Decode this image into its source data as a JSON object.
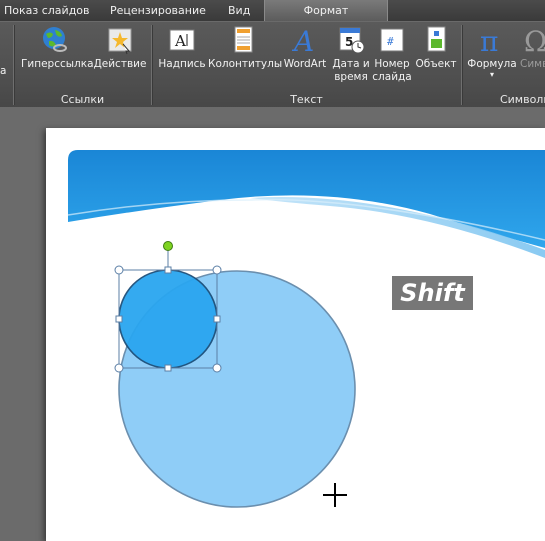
{
  "tabs": [
    {
      "label": "Показ слайдов"
    },
    {
      "label": "Рецензирование"
    },
    {
      "label": "Вид"
    },
    {
      "label": "Формат"
    }
  ],
  "ribbon": {
    "cut_label": "а",
    "groups": {
      "links": "Ссылки",
      "text": "Текст",
      "symbols": "Символы"
    },
    "buttons": {
      "hyperlink": "Гиперссылка",
      "action": "Действие",
      "textbox": "Надпись",
      "header_footer": "Колонтитулы",
      "wordart": "WordArt",
      "datetime_1": "Дата и",
      "datetime_2": "время",
      "slide_number_1": "Номер",
      "slide_number_2": "слайда",
      "object": "Объект",
      "equation": "Формула",
      "symbol_cut": "Симв"
    }
  },
  "overlay": {
    "key_hint": "Shift"
  },
  "colors": {
    "tab_bar": "#3f3f3f",
    "ribbon": "#545454",
    "slide_bg": "#ffffff",
    "banner_blue": "#1b8ad8",
    "large_circle_fill": "#8fcdf7",
    "small_circle_fill": "#2aa6f0",
    "selection_handle": "#7ed321"
  }
}
